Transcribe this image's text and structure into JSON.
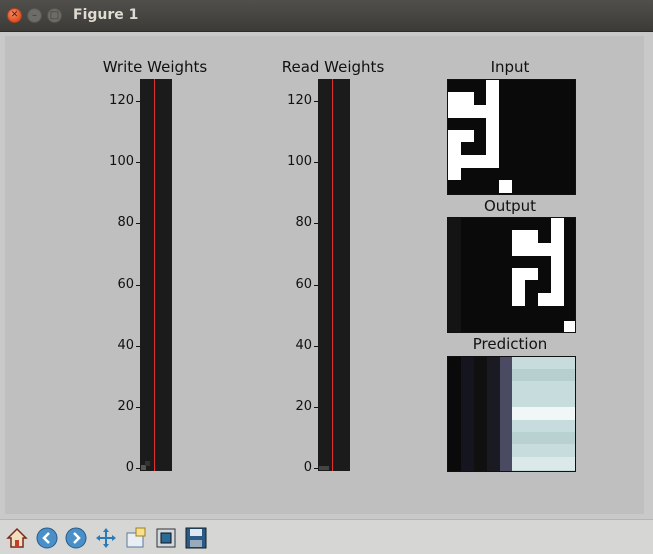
{
  "window": {
    "title": "Figure 1"
  },
  "panels": {
    "write": {
      "title": "Write Weights",
      "ticks": [
        "120",
        "100",
        "80",
        "60",
        "40",
        "20",
        "0"
      ]
    },
    "read": {
      "title": "Read Weights",
      "ticks": [
        "120",
        "100",
        "80",
        "60",
        "40",
        "20",
        "0"
      ]
    },
    "input": {
      "title": "Input"
    },
    "output": {
      "title": "Output"
    },
    "prediction": {
      "title": "Prediction"
    }
  },
  "toolbar": {
    "buttons": [
      {
        "name": "home-button",
        "icon": "home-icon"
      },
      {
        "name": "back-button",
        "icon": "back-arrow-icon"
      },
      {
        "name": "forward-button",
        "icon": "forward-arrow-icon"
      },
      {
        "name": "pan-button",
        "icon": "move-icon"
      },
      {
        "name": "zoom-button",
        "icon": "zoom-rect-icon"
      },
      {
        "name": "configure-subplots-button",
        "icon": "subplots-icon"
      },
      {
        "name": "save-button",
        "icon": "save-icon"
      }
    ]
  },
  "colors": {
    "accent_red": "#e23030",
    "matrix_dark": "#0a0a0a",
    "prediction_light": "#d6e6e6"
  }
}
